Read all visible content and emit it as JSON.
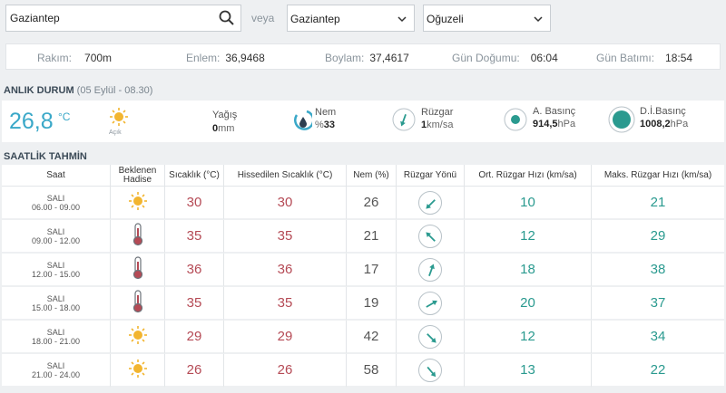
{
  "search": {
    "value": "Gaziantep"
  },
  "veya": "veya",
  "province_select": {
    "value": "Gaziantep"
  },
  "district_select": {
    "value": "Oğuzeli"
  },
  "info": {
    "rakim_label": "Rakım:",
    "rakim_value": "700m",
    "enlem_label": "Enlem:",
    "enlem_value": "36,9468",
    "boylam_label": "Boylam:",
    "boylam_value": "37,4617",
    "gundogumu_label": "Gün Doğumu:",
    "gundogumu_value": "06:04",
    "gunbatimi_label": "Gün Batımı:",
    "gunbatimi_value": "18:54"
  },
  "current": {
    "title": "ANLIK DURUM",
    "subtitle": "(05 Eylül - 08.30)",
    "temperature": "26,8",
    "temp_unit": "°C",
    "condition": "Açık",
    "rain_label": "Yağış",
    "rain_value": "0",
    "rain_unit": "mm",
    "humidity_label": "Nem",
    "humidity_prefix": "%",
    "humidity_value": "33",
    "wind_label": "Rüzgar",
    "wind_value": "1",
    "wind_unit": "km/sa",
    "pressure_label": "A. Basınç",
    "pressure_value": "914,5",
    "pressure_unit": "hPa",
    "sea_pressure_label": "D.İ.Basınç",
    "sea_pressure_value": "1008,2",
    "sea_pressure_unit": "hPa"
  },
  "forecast": {
    "title": "SAATLİK TAHMİN",
    "headers": {
      "saat": "Saat",
      "hadise_1": "Beklenen",
      "hadise_2": "Hadise",
      "sicaklik": "Sıcaklık (°C)",
      "hissedilen": "Hissedilen Sıcaklık (°C)",
      "nem": "Nem (%)",
      "yon": "Rüzgar Yönü",
      "ort": "Ort. Rüzgar Hızı (km/sa)",
      "maks": "Maks. Rüzgar Hızı (km/sa)"
    },
    "rows": [
      {
        "day": "SALI",
        "time": "06.00 - 09.00",
        "icon": "sun-icon",
        "temp": "30",
        "feels": "30",
        "humidity": "26",
        "wind_dir_deg": 225,
        "avg": "10",
        "max": "21"
      },
      {
        "day": "SALI",
        "time": "09.00 - 12.00",
        "icon": "thermometer-icon",
        "temp": "35",
        "feels": "35",
        "humidity": "21",
        "wind_dir_deg": 315,
        "avg": "12",
        "max": "29"
      },
      {
        "day": "SALI",
        "time": "12.00 - 15.00",
        "icon": "thermometer-icon",
        "temp": "36",
        "feels": "36",
        "humidity": "17",
        "wind_dir_deg": 20,
        "avg": "18",
        "max": "38"
      },
      {
        "day": "SALI",
        "time": "15.00 - 18.00",
        "icon": "thermometer-icon",
        "temp": "35",
        "feels": "35",
        "humidity": "19",
        "wind_dir_deg": 60,
        "avg": "20",
        "max": "37"
      },
      {
        "day": "SALI",
        "time": "18.00 - 21.00",
        "icon": "sun-icon",
        "temp": "29",
        "feels": "29",
        "humidity": "42",
        "wind_dir_deg": 135,
        "avg": "12",
        "max": "34"
      },
      {
        "day": "SALI",
        "time": "21.00 - 24.00",
        "icon": "sun-icon",
        "temp": "26",
        "feels": "26",
        "humidity": "58",
        "wind_dir_deg": 140,
        "avg": "13",
        "max": "22"
      }
    ]
  },
  "colors": {
    "accent": "#3aa8c8",
    "temp_red": "#b54a55",
    "teal": "#2a9a8f",
    "sun": "#f2b530",
    "thermo": "#b54a55"
  }
}
